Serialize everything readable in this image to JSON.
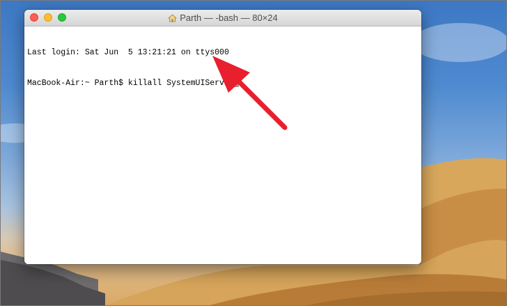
{
  "window": {
    "title": "Parth — -bash — 80×24",
    "title_icon": "home-icon"
  },
  "terminal": {
    "lines": [
      "Last login: Sat Jun  5 13:21:21 on ttys000",
      "MacBook-Air:~ Parth$ killall SystemUIServer"
    ]
  },
  "annotation": {
    "arrow_color": "#e8202e"
  },
  "colors": {
    "close": "#fe5f57",
    "minimize": "#febc2e",
    "zoom": "#28c840"
  }
}
